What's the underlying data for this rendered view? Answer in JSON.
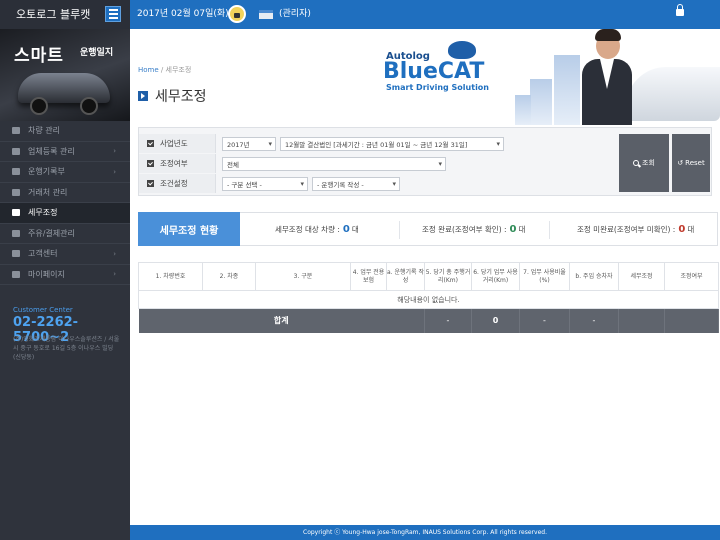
{
  "header": {
    "brand": "오토로그 블루캣",
    "date": "2017년 02월 07일(화)",
    "admin": "(관리자)"
  },
  "promo": {
    "title": "스마트",
    "subtitle": "운행일지"
  },
  "sidebar": {
    "items": [
      {
        "label": "차량 관리",
        "icon": "car-icon",
        "chevron": false
      },
      {
        "label": "업체등록 관리",
        "icon": "gear-icon",
        "chevron": true
      },
      {
        "label": "운행기록부",
        "icon": "grid-icon",
        "chevron": true
      },
      {
        "label": "거래처 관리",
        "icon": "document-icon",
        "chevron": false
      },
      {
        "label": "세무조정",
        "icon": "calculator-icon",
        "chevron": false,
        "active": true
      },
      {
        "label": "주유/결제관리",
        "icon": "card-icon",
        "chevron": false
      },
      {
        "label": "고객센터",
        "icon": "headset-icon",
        "chevron": true
      },
      {
        "label": "마이페이지",
        "icon": "user-icon",
        "chevron": true
      }
    ],
    "customer_center_label": "Customer Center",
    "phone": "02-2262-5700~2",
    "address": "(주)영화조세통람 이나우스솔루션즈 / 서울시 중구 동호로 16길 5층 이나우스 빌딩(신당동)"
  },
  "page": {
    "breadcrumb_home": "Home",
    "breadcrumb_sep": "/",
    "breadcrumb_current": "세무조정",
    "title": "세무조정"
  },
  "logo": {
    "top": "Autolog",
    "main": "BlueCAT",
    "sub": "Smart Driving Solution"
  },
  "filter": {
    "year_label": "사업년도",
    "year_value": "2017년",
    "period_value": "12월말 결산법인 [과세기간 : 금년 01월 01일 ~ 금년 12월 31일]",
    "adjust_label": "조정여부",
    "adjust_value": "전체",
    "cond_label": "조건설정",
    "cond1_value": "- 구분 선택 -",
    "cond2_value": "- 운행기록 작성 -",
    "search_button": "조회",
    "reset_button": "Reset"
  },
  "status": {
    "tab": "세무조정 현황",
    "target_label": "세무조정 대상 차량 :",
    "target_value": "0",
    "target_unit": "대",
    "done_label": "조정 완료(조정여부 확인) :",
    "done_value": "0",
    "done_unit": "대",
    "pending_label": "조정 미완료(조정여부 미확인) :",
    "pending_value": "0",
    "pending_unit": "대"
  },
  "table": {
    "headers": [
      "1. 차량번호",
      "2. 차종",
      "3. 구분",
      "4. 업무 전용보험",
      "a. 운행기록 작성",
      "5. 당기 총 주행거리(Km)",
      "6. 당기 업무 사용거리(Km)",
      "7. 업무 사용비율(%)",
      "b. 주임 승차자",
      "세무조정",
      "조정여부"
    ],
    "empty_message": "해당내용이 없습니다.",
    "sum_label": "합계",
    "sum_values": [
      "-",
      "0",
      "-",
      "-"
    ]
  },
  "footer": "Copyright ⓒ Young-Hwa jose-TongRam, INAUS Solutions Corp. All rights reserved."
}
